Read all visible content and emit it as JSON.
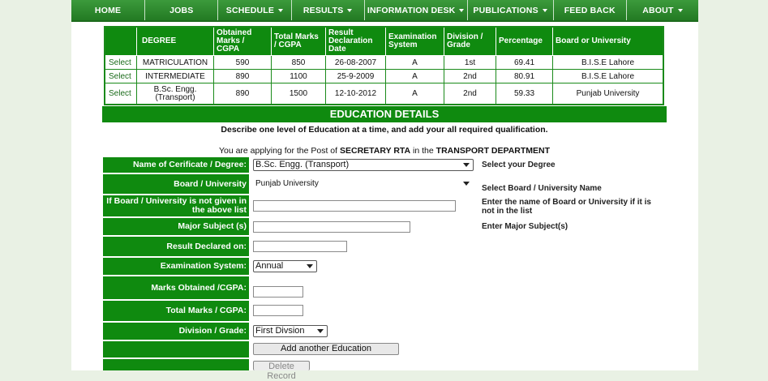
{
  "nav": {
    "items": [
      {
        "label": "HOME",
        "dropdown": false
      },
      {
        "label": "JOBS",
        "dropdown": false
      },
      {
        "label": "SCHEDULE",
        "dropdown": true
      },
      {
        "label": "RESULTS",
        "dropdown": true
      },
      {
        "label": "INFORMATION DESK",
        "dropdown": true
      },
      {
        "label": "PUBLICATIONS",
        "dropdown": true
      },
      {
        "label": "FEED BACK",
        "dropdown": false
      },
      {
        "label": "ABOUT",
        "dropdown": true
      }
    ]
  },
  "summary": {
    "headers": [
      "",
      "DEGREE",
      "Obtained Marks / CGPA",
      "Total Marks / CGPA",
      "Result Declaration Date",
      "Examination System",
      "Division / Grade",
      "Percentage",
      "Board or University"
    ],
    "rows": [
      {
        "action": "Select",
        "degree": "MATRICULATION",
        "obtained": "590",
        "total": "850",
        "date": "26-08-2007",
        "system": "A",
        "division": "1st",
        "percentage": "69.41",
        "board": "B.I.S.E Lahore"
      },
      {
        "action": "Select",
        "degree": "INTERMEDIATE",
        "obtained": "890",
        "total": "1100",
        "date": "25-9-2009",
        "system": "A",
        "division": "2nd",
        "percentage": "80.91",
        "board": "B.I.S.E Lahore"
      },
      {
        "action": "Select",
        "degree": "B.Sc. Engg. (Transport)",
        "obtained": "890",
        "total": "1500",
        "date": "12-10-2012",
        "system": "A",
        "division": "2nd",
        "percentage": "59.33",
        "board": "Punjab University"
      }
    ]
  },
  "section": {
    "title": "EDUCATION DETAILS",
    "instruction": "Describe one level of Education at a time, and add your all required qualification.",
    "applying_prefix": "You are applying for the Post of",
    "post": "SECRETARY RTA",
    "applying_middle": "in the",
    "department": "TRANSPORT DEPARTMENT"
  },
  "form": {
    "degree_label": "Name of Cerificate / Degree:",
    "degree_value": "B.Sc. Engg. (Transport)",
    "degree_hint": "Select your Degree",
    "board_label": "Board / University",
    "board_value": "Punjab University",
    "board_hint": "Select Board / University Name",
    "other_board_label": "If Board / University is not given in the above list",
    "other_board_value": "",
    "other_board_hint": "Enter the name of Board or University if it is not in the list",
    "subject_label": "Major Subject (s)",
    "subject_value": "",
    "subject_hint": "Enter Major Subject(s)",
    "result_label": "Result Declared on:",
    "result_value": "",
    "exam_label": "Examination System:",
    "exam_value": "Annual",
    "marks_label": "Marks Obtained /CGPA:",
    "marks_value": "",
    "total_label": "Total Marks / CGPA:",
    "total_value": "",
    "division_label": "Division / Grade:",
    "division_value": "First Divsion",
    "add_button": "Add another Education",
    "delete_button": "Delete Record"
  }
}
